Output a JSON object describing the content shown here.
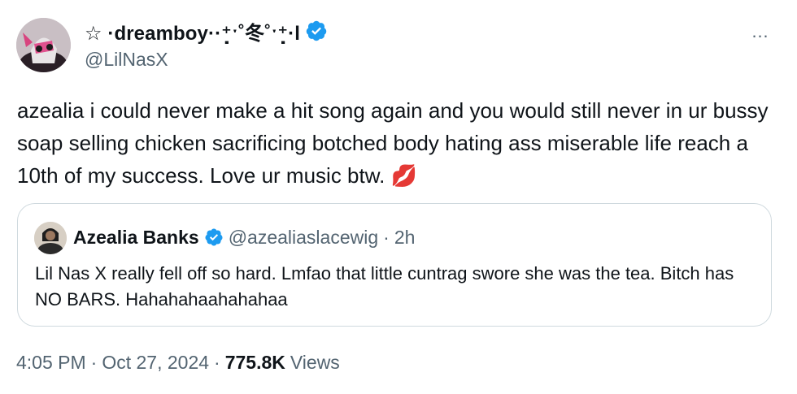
{
  "author": {
    "display_name": "☆ ·dreamboy··⁺̣ˑ˚冬˚ˑ⁺̣·l",
    "handle": "@LilNasX",
    "verified": true
  },
  "more_icon": "…",
  "tweet_text": "azealia i could never make a hit song again and you would still never in ur bussy soap selling chicken sacrificing botched body hating ass miserable life reach a 10th of my success. Love ur music btw. 💋",
  "quoted": {
    "display_name": "Azealia Banks",
    "handle": "@azealiaslacewig",
    "separator": "·",
    "time": "2h",
    "verified": true,
    "text": "Lil Nas X really fell off so hard. Lmfao that little cuntrag swore she was the tea. Bitch has NO BARS. Hahahahaahahahaa"
  },
  "meta": {
    "time": "4:05 PM",
    "sep1": "·",
    "date": "Oct 27, 2024",
    "sep2": "·",
    "views_count": "775.8K",
    "views_label": "Views"
  },
  "colors": {
    "verified_blue": "#1d9bf0",
    "secondary_text": "#536471",
    "primary_text": "#0f1419",
    "border": "#cfd9de"
  }
}
